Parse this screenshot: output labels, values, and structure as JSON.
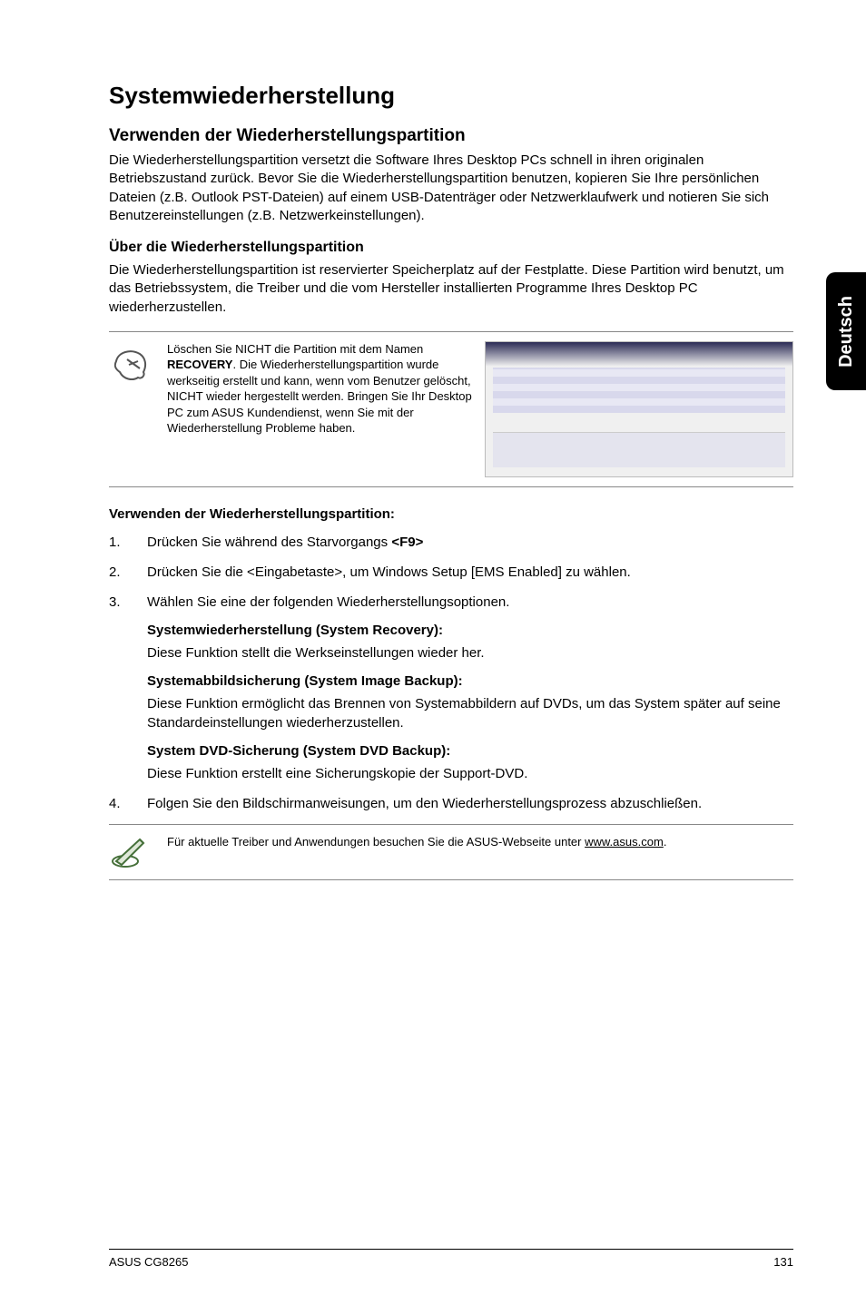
{
  "sideTab": "Deutsch",
  "title": "Systemwiederherstellung",
  "sec1": {
    "heading": "Verwenden der Wiederherstellungspartition",
    "body": "Die Wiederherstellungspartition versetzt die Software Ihres Desktop PCs schnell in ihren originalen Betriebszustand zurück. Bevor Sie die Wiederherstellungspartition benutzen, kopieren Sie Ihre persönlichen Dateien (z.B. Outlook PST-Dateien) auf einem USB-Datenträger oder Netzwerklaufwerk und notieren Sie sich Benutzereinstellungen (z.B. Netzwerkeinstellungen)."
  },
  "sec2": {
    "heading": "Über die Wiederherstellungspartition",
    "body": "Die Wiederherstellungspartition ist reservierter Speicherplatz auf der Festplatte. Diese Partition wird benutzt, um das Betriebssystem, die Treiber und die vom Hersteller installierten Programme Ihres Desktop PC wiederherzustellen."
  },
  "note1": {
    "pre": "Löschen Sie NICHT die Partition mit dem Namen ",
    "bold": "RECOVERY",
    "post": ". Die Wiederherstellungspartition wurde werkseitig erstellt und kann, wenn vom Benutzer gelöscht, NICHT wieder hergestellt werden. Bringen Sie Ihr Desktop PC zum ASUS Kundendienst, wenn Sie mit der Wiederherstellung Probleme haben."
  },
  "listHeading": "Verwenden der Wiederherstellungspartition:",
  "steps": {
    "s1_pre": "Drücken Sie während des Starvorgangs ",
    "s1_bold": "<F9>",
    "s2": "Drücken Sie die <Eingabetaste>, um Windows Setup [EMS Enabled] zu wählen.",
    "s3": "Wählen Sie eine der folgenden Wiederherstellungsoptionen.",
    "s4": "Folgen Sie den Bildschirmanweisungen, um den Wiederherstellungsprozess abzuschließen."
  },
  "options": {
    "o1h": "Systemwiederherstellung (System Recovery):",
    "o1b": "Diese Funktion stellt die Werkseinstellungen wieder her.",
    "o2h": "Systemabbildsicherung (System Image Backup):",
    "o2b": "Diese Funktion ermöglicht das Brennen von Systemabbildern auf DVDs, um das System später auf seine Standardeinstellungen wiederherzustellen.",
    "o3h": "System DVD-Sicherung (System DVD Backup):",
    "o3b": "Diese Funktion erstellt eine Sicherungskopie der Support-DVD."
  },
  "note2": {
    "pre": "Für aktuelle Treiber und Anwendungen besuchen Sie die ASUS-Webseite unter ",
    "link": "www.asus.com",
    "post": "."
  },
  "footer": {
    "left": "ASUS CG8265",
    "right": "131"
  }
}
